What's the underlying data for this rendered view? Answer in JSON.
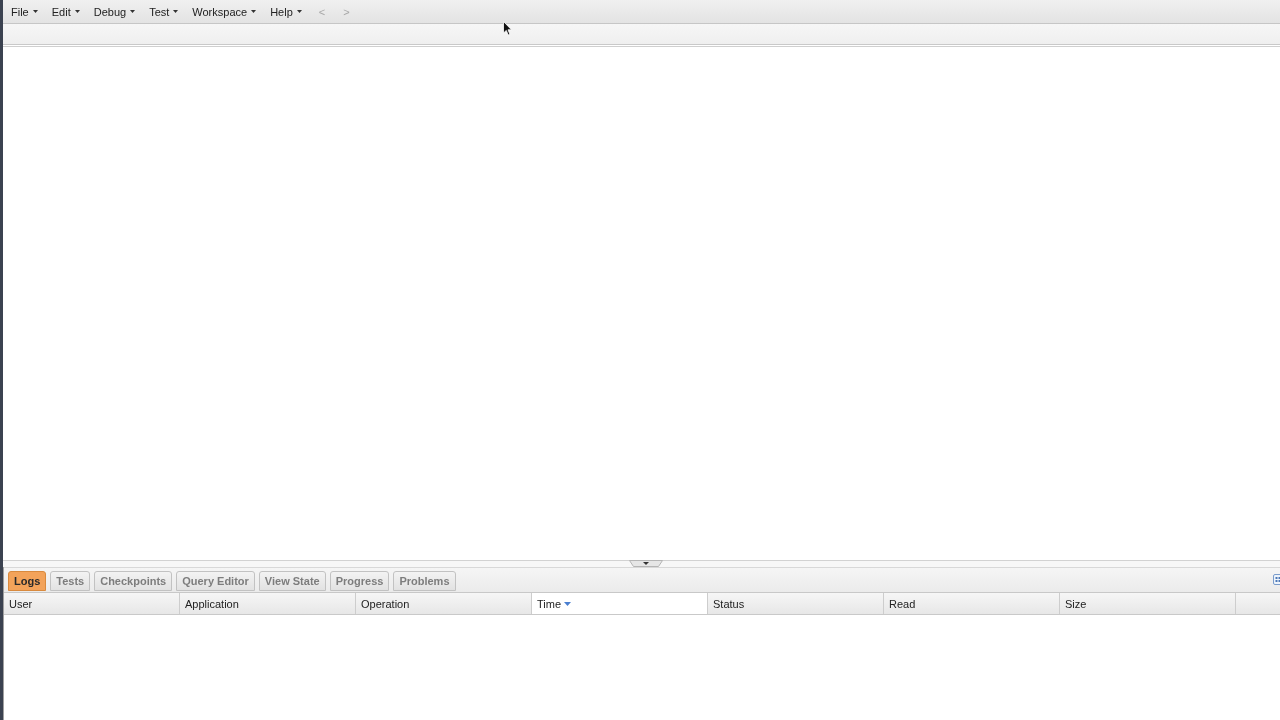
{
  "menu_bar": {
    "menus": [
      {
        "label": "File"
      },
      {
        "label": "Edit"
      },
      {
        "label": "Debug"
      },
      {
        "label": "Test"
      },
      {
        "label": "Workspace"
      },
      {
        "label": "Help"
      }
    ],
    "history_buttons": [
      {
        "label": "<",
        "disabled": true
      },
      {
        "label": ">",
        "disabled": true
      }
    ]
  },
  "bottom_panel": {
    "tabs": [
      {
        "label": "Logs",
        "selected": true
      },
      {
        "label": "Tests",
        "selected": false
      },
      {
        "label": "Checkpoints",
        "selected": false
      },
      {
        "label": "Query Editor",
        "selected": false
      },
      {
        "label": "View State",
        "selected": false
      },
      {
        "label": "Progress",
        "selected": false
      },
      {
        "label": "Problems",
        "selected": false
      }
    ],
    "table": {
      "columns": [
        {
          "label": "User",
          "sorted": false
        },
        {
          "label": "Application",
          "sorted": false
        },
        {
          "label": "Operation",
          "sorted": false
        },
        {
          "label": "Time",
          "sorted": true
        },
        {
          "label": "Status",
          "sorted": false
        },
        {
          "label": "Read",
          "sorted": false
        },
        {
          "label": "Size",
          "sorted": false
        }
      ]
    }
  }
}
